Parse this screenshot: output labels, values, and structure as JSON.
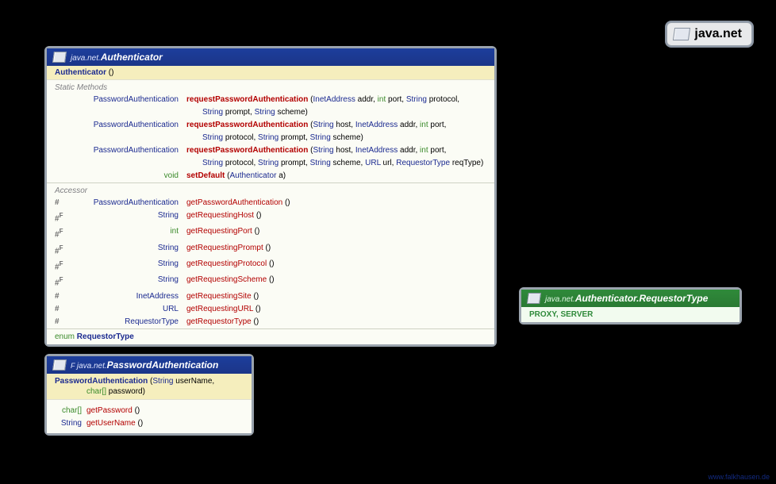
{
  "package_badge": {
    "name": "java.net"
  },
  "watermark": "www.falkhausen.de",
  "auth": {
    "pkg": "java.net.",
    "cls": "Authenticator",
    "ctor": "Authenticator",
    "ctor_params": "()",
    "staticHeader": "Static Methods",
    "accessorHeader": "Accessor",
    "static": [
      {
        "ret": "PasswordAuthentication",
        "name": "requestPasswordAuthentication",
        "params": "(InetAddress addr, int port, String protocol,",
        "params2": "String prompt, String scheme)"
      },
      {
        "ret": "PasswordAuthentication",
        "name": "requestPasswordAuthentication",
        "params": "(String host, InetAddress addr, int port,",
        "params2": "String protocol, String prompt, String scheme)"
      },
      {
        "ret": "PasswordAuthentication",
        "name": "requestPasswordAuthentication",
        "params": "(String host, InetAddress addr, int port,",
        "params2": "String protocol, String prompt, String scheme, URL url, RequestorType reqType)"
      },
      {
        "ret": "void",
        "retIsKeyword": true,
        "name": "setDefault",
        "params": "(Authenticator a)"
      }
    ],
    "accessors": [
      {
        "mod": "#",
        "ret": "PasswordAuthentication",
        "name": "getPasswordAuthentication",
        "params": "()"
      },
      {
        "mod": "#F",
        "ret": "String",
        "name": "getRequestingHost",
        "params": "()"
      },
      {
        "mod": "#F",
        "ret": "int",
        "retIsKeyword": true,
        "name": "getRequestingPort",
        "params": "()"
      },
      {
        "mod": "#F",
        "ret": "String",
        "name": "getRequestingPrompt",
        "params": "()"
      },
      {
        "mod": "#F",
        "ret": "String",
        "name": "getRequestingProtocol",
        "params": "()"
      },
      {
        "mod": "#F",
        "ret": "String",
        "name": "getRequestingScheme",
        "params": "()"
      },
      {
        "mod": "#",
        "ret": "InetAddress",
        "name": "getRequestingSite",
        "params": "()"
      },
      {
        "mod": "#",
        "ret": "URL",
        "name": "getRequestingURL",
        "params": "()"
      },
      {
        "mod": "#",
        "ret": "RequestorType",
        "name": "getRequestorType",
        "params": "()"
      }
    ],
    "enumKeyword": "enum",
    "enumName": "RequestorType"
  },
  "reqtype": {
    "pkg": "java.net.",
    "cls": "Authenticator.RequestorType",
    "values": "PROXY, SERVER"
  },
  "pwauth": {
    "pkg": "java.net.",
    "cls": "PasswordAuthentication",
    "ctor": "PasswordAuthentication",
    "ctor_params1": "(String userName,",
    "ctor_params2_type": "char[]",
    "ctor_params2_name": " password)",
    "methods": [
      {
        "ret": "char[]",
        "retIsKeyword": true,
        "name": "getPassword",
        "params": "()"
      },
      {
        "ret": "String",
        "name": "getUserName",
        "params": "()"
      }
    ]
  },
  "types": {
    "InetAddress": "InetAddress",
    "String": "String",
    "URL": "URL",
    "RequestorType": "RequestorType",
    "Authenticator": "Authenticator"
  }
}
